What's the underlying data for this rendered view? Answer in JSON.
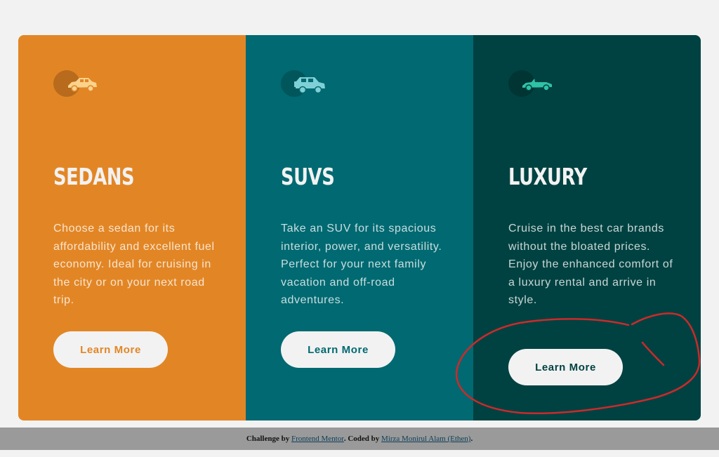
{
  "cards": [
    {
      "icon": "sedan-car-icon",
      "title": "SEDANS",
      "text": "Choose a sedan for its affordability and excellent fuel economy. Ideal for cruising in the city or on your next road trip.",
      "button": "Learn More",
      "color": "#e28625"
    },
    {
      "icon": "suv-car-icon",
      "title": "SUVS",
      "text": "Take an SUV for its spacious interior, power, and versatility. Perfect for your next family vacation and off-road adventures.",
      "button": "Learn More",
      "color": "#006971"
    },
    {
      "icon": "luxury-car-icon",
      "title": "LUXURY",
      "text": "Cruise in the best car brands without the bloated prices. Enjoy the enhanced comfort of a luxury rental and arrive in style.",
      "button": "Learn More",
      "color": "#004241"
    }
  ],
  "footer": {
    "prefix": "Challenge by ",
    "link1": "Frontend Mentor",
    "middle": ". Coded by ",
    "link2": "Mirza Monirul Alam (Ethen)",
    "suffix": "."
  },
  "colors": {
    "background": "#f2f2f2",
    "annotation_circle": "#cc2a2a",
    "footer_bg": "#9a9a9a"
  }
}
